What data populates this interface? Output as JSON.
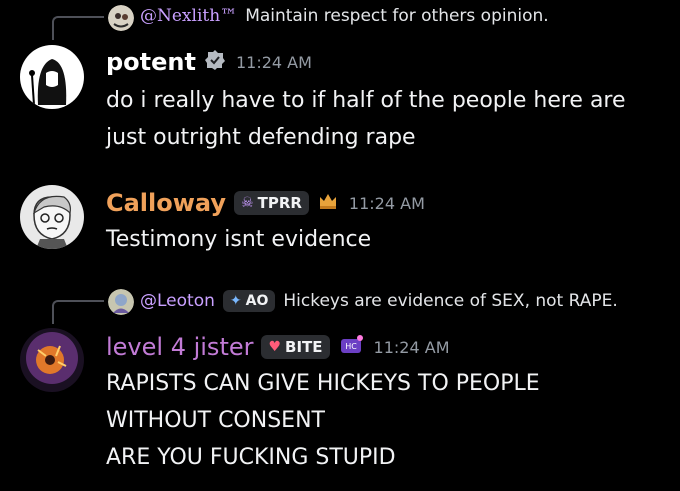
{
  "messages": [
    {
      "reply": {
        "name": "@Nexlith™",
        "text": "Maintain respect for others opinion."
      },
      "author": "potent",
      "author_color": "#ffffff",
      "time": "11:24 AM",
      "lines": [
        "do i really have to if half of the people here are",
        "just outright defending rape"
      ]
    },
    {
      "author": "Calloway",
      "author_color": "#f0a15a",
      "tag": {
        "icon": "skull-icon",
        "label": "TPRR"
      },
      "time": "11:24 AM",
      "lines": [
        "Testimony isnt evidence"
      ]
    },
    {
      "reply": {
        "name": "@Leoton",
        "tag": "AO",
        "text": "Hickeys are evidence of SEX, not RAPE."
      },
      "author": "level 4 jister",
      "author_color": "#c27bd6",
      "tag": {
        "icon": "bite-icon",
        "label": "BITE"
      },
      "time": "11:24 AM",
      "lines": [
        "RAPISTS CAN GIVE HICKEYS TO PEOPLE",
        "WITHOUT CONSENT",
        "ARE YOU FUCKING STUPID"
      ]
    }
  ]
}
